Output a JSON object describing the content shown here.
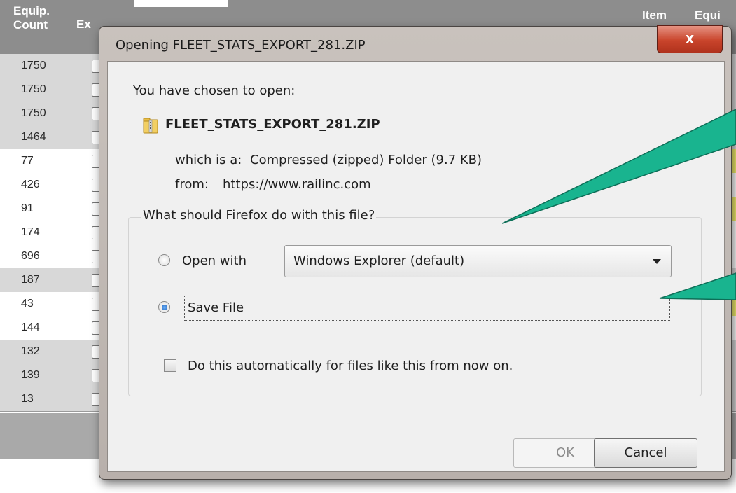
{
  "background_table": {
    "header": {
      "equip_count": "Equip.\nCount",
      "exp_partial": "Ex",
      "item": "Item",
      "equip_partial": "Equi"
    },
    "rows": [
      {
        "count": "1750",
        "shade": "gray"
      },
      {
        "count": "1750",
        "shade": "gray"
      },
      {
        "count": "1750",
        "shade": "gray"
      },
      {
        "count": "1464",
        "shade": "gray"
      },
      {
        "count": "77",
        "shade": "white"
      },
      {
        "count": "426",
        "shade": "white"
      },
      {
        "count": "91",
        "shade": "white"
      },
      {
        "count": "174",
        "shade": "white"
      },
      {
        "count": "696",
        "shade": "white"
      },
      {
        "count": "187",
        "shade": "gray"
      },
      {
        "count": "43",
        "shade": "white"
      },
      {
        "count": "144",
        "shade": "white"
      },
      {
        "count": "132",
        "shade": "gray"
      },
      {
        "count": "139",
        "shade": "gray"
      },
      {
        "count": "13",
        "shade": "gray"
      }
    ]
  },
  "dialog": {
    "title": "Opening FLEET_STATS_EXPORT_281.ZIP",
    "close_label": "x",
    "chosen_label": "You have chosen to open:",
    "file_name": "FLEET_STATS_EXPORT_281.ZIP",
    "file_icon": "zip-folder-icon",
    "which_is_label": "which is a:",
    "file_type": "Compressed (zipped) Folder (9.7 KB)",
    "from_label": "from:",
    "source_url": "https://www.railinc.com",
    "group_label": "What should Firefox do with this file?",
    "open_with_label": "Open with",
    "open_with_value": "Windows Explorer (default)",
    "save_file_label": "Save File",
    "selected_option": "save_file",
    "auto_label": "Do this automatically for files like this from now on.",
    "auto_checked": false,
    "ok_label": "OK",
    "cancel_label": "Cancel"
  },
  "colors": {
    "callout": "#19b48f",
    "titlebar": "#c4bdb8",
    "close_button": "#c9442b",
    "header_bg": "#8d8d8d"
  }
}
